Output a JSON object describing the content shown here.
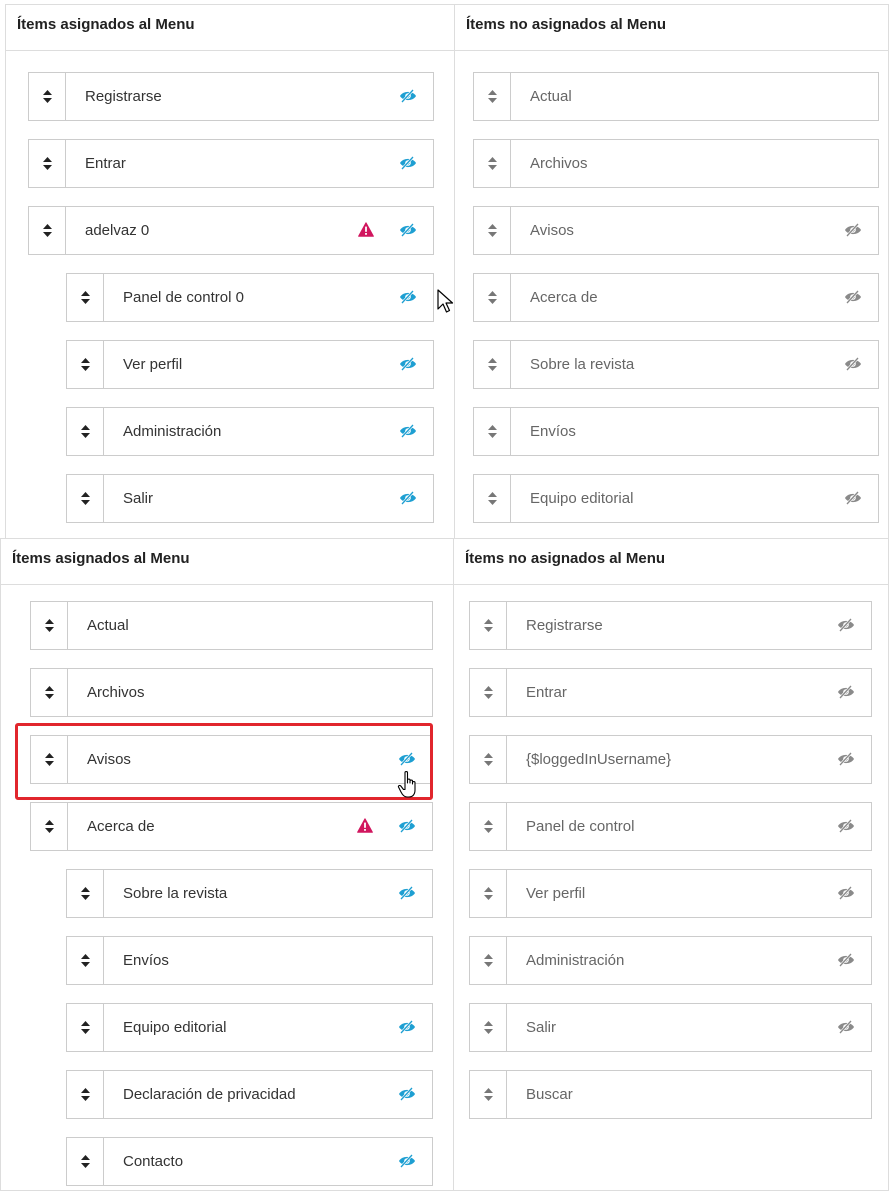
{
  "top": {
    "assigned_header": "Ítems asignados al Menu",
    "unassigned_header": "Ítems no asignados al Menu",
    "assigned_items": [
      {
        "label": "Registrarse",
        "visibility": "visible-eye-icon",
        "warning": false,
        "nested": false
      },
      {
        "label": "Entrar",
        "visibility": "visible-eye-icon",
        "warning": false,
        "nested": false
      },
      {
        "label": "adelvaz 0",
        "visibility": "visible-eye-icon",
        "warning": true,
        "nested": false
      },
      {
        "label": "Panel de control 0",
        "visibility": "visible-eye-icon",
        "warning": false,
        "nested": true
      },
      {
        "label": "Ver perfil",
        "visibility": "visible-eye-icon",
        "warning": false,
        "nested": true
      },
      {
        "label": "Administración",
        "visibility": "visible-eye-icon",
        "warning": false,
        "nested": true
      },
      {
        "label": "Salir",
        "visibility": "visible-eye-icon",
        "warning": false,
        "nested": true
      }
    ],
    "unassigned_items": [
      {
        "label": "Actual",
        "visibility": "none"
      },
      {
        "label": "Archivos",
        "visibility": "none"
      },
      {
        "label": "Avisos",
        "visibility": "hidden-eye-icon"
      },
      {
        "label": "Acerca de",
        "visibility": "hidden-eye-icon"
      },
      {
        "label": "Sobre la revista",
        "visibility": "hidden-eye-icon"
      },
      {
        "label": "Envíos",
        "visibility": "none"
      },
      {
        "label": "Equipo editorial",
        "visibility": "hidden-eye-icon"
      }
    ]
  },
  "bottom": {
    "assigned_header": "Ítems asignados al Menu",
    "unassigned_header": "Ítems no asignados al Menu",
    "assigned_items": [
      {
        "label": "Actual",
        "visibility": "none",
        "warning": false,
        "nested": false
      },
      {
        "label": "Archivos",
        "visibility": "none",
        "warning": false,
        "nested": false
      },
      {
        "label": "Avisos",
        "visibility": "visible-eye-icon",
        "warning": false,
        "nested": false,
        "highlighted": true
      },
      {
        "label": "Acerca de",
        "visibility": "visible-eye-icon",
        "warning": true,
        "nested": false
      },
      {
        "label": "Sobre la revista",
        "visibility": "visible-eye-icon",
        "warning": false,
        "nested": true
      },
      {
        "label": "Envíos",
        "visibility": "none",
        "warning": false,
        "nested": true
      },
      {
        "label": "Equipo editorial",
        "visibility": "visible-eye-icon",
        "warning": false,
        "nested": true
      },
      {
        "label": "Declaración de privacidad",
        "visibility": "visible-eye-icon",
        "warning": false,
        "nested": true
      },
      {
        "label": "Contacto",
        "visibility": "visible-eye-icon",
        "warning": false,
        "nested": true
      }
    ],
    "unassigned_items": [
      {
        "label": "Registrarse",
        "visibility": "hidden-eye-icon"
      },
      {
        "label": "Entrar",
        "visibility": "hidden-eye-icon"
      },
      {
        "label": "{$loggedInUsername}",
        "visibility": "hidden-eye-icon"
      },
      {
        "label": "Panel de control",
        "visibility": "hidden-eye-icon"
      },
      {
        "label": "Ver perfil",
        "visibility": "hidden-eye-icon"
      },
      {
        "label": "Administración",
        "visibility": "hidden-eye-icon"
      },
      {
        "label": "Salir",
        "visibility": "hidden-eye-icon"
      },
      {
        "label": "Buscar",
        "visibility": "none"
      }
    ]
  },
  "colors": {
    "eye_visible": "#1e9fd2",
    "eye_hidden": "#8a8a8a",
    "warning": "#d1165e",
    "highlight": "#e1262d",
    "border": "#cccccc"
  }
}
